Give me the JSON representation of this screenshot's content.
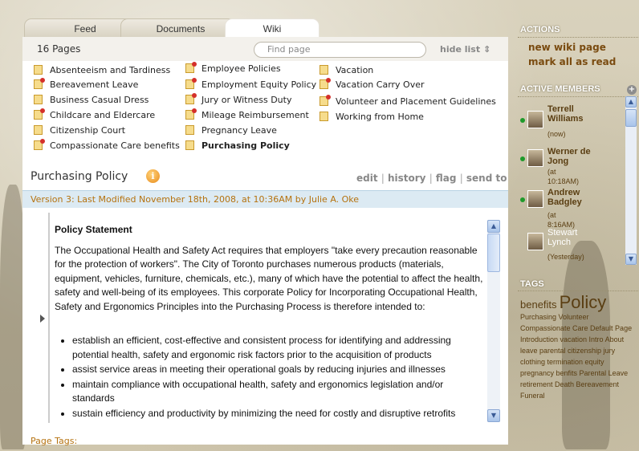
{
  "tabs": {
    "feed": "Feed",
    "documents": "Documents",
    "wiki": "Wiki"
  },
  "page_count": "16 Pages",
  "find_placeholder": "Find page",
  "hide_list": "hide list ⇕",
  "pages": [
    {
      "label": "Absenteeism and Tardiness",
      "pinned": false
    },
    {
      "label": "Bereavement Leave",
      "pinned": true
    },
    {
      "label": "Business Casual Dress",
      "pinned": false
    },
    {
      "label": "Childcare and Eldercare",
      "pinned": true
    },
    {
      "label": "Citizenship Court",
      "pinned": false
    },
    {
      "label": "Compassionate Care benefits",
      "pinned": true
    },
    {
      "label": "Employee Policies",
      "pinned": true
    },
    {
      "label": "Employment Equity Policy",
      "pinned": true
    },
    {
      "label": "Jury or Witness Duty",
      "pinned": true
    },
    {
      "label": "Mileage Reimbursement",
      "pinned": true
    },
    {
      "label": "Pregnancy Leave",
      "pinned": false
    },
    {
      "label": "Purchasing Policy",
      "pinned": false,
      "current": true
    },
    {
      "label": "Vacation",
      "pinned": false
    },
    {
      "label": "Vacation Carry Over",
      "pinned": true
    },
    {
      "label": "Volunteer and Placement Guidelines",
      "pinned": true
    },
    {
      "label": "Working from Home",
      "pinned": false
    }
  ],
  "page_title": "Purchasing Policy",
  "page_actions": {
    "edit": "edit",
    "history": "history",
    "flag": "flag",
    "send_to": "send to"
  },
  "version_text": "Version 3: Last Modified November 18th, 2008, at 10:36AM by Julie A. Oke",
  "policy": {
    "heading": "Policy Statement",
    "body": "The Occupational Health and Safety Act requires that employers \"take every precaution reasonable for the protection of workers\". The City of Toronto purchases numerous products (materials, equipment, vehicles, furniture, chemicals, etc.), many of which have the potential to affect the health, safety and well-being of its employees. This corporate Policy for Incorporating Occupational Health, Safety and Ergonomics Principles into the Purchasing Process is therefore intended to:",
    "bullets": [
      "establish an efficient, cost-effective and consistent process for identifying and addressing potential health, safety and ergonomic risk factors prior to the acquisition of products",
      "assist service areas in meeting their operational goals by reducing injuries and illnesses",
      "maintain compliance with occupational health, safety and ergonomics legislation and/or standards",
      "sustain efficiency and productivity by minimizing the need for costly and disruptive retrofits"
    ]
  },
  "page_tags_label": "Page Tags:",
  "right": {
    "actions_heading": "ACTIONS",
    "new_wiki_page": "new wiki page",
    "mark_all_read": "mark all as read",
    "members_heading": "ACTIVE MEMBERS",
    "members": [
      {
        "name": "Terrell Williams",
        "time": "(now)",
        "online": true
      },
      {
        "name": "Werner de Jong",
        "time": "(at 10:18AM)",
        "online": true
      },
      {
        "name": "Andrew Badgley",
        "time": "(at 8:16AM)",
        "online": true
      },
      {
        "name": "Stewart Lynch",
        "time": "(Yesterday)",
        "online": false
      }
    ],
    "tags_heading": "TAGS",
    "tags": {
      "benefits": "benefits",
      "policy": "Policy",
      "rest": "Purchasing Volunteer Compassionate Care Default Page Introduction vacation Intro About leave parental citizenship jury clothing termination equity pregnancy benfits Parental Leave retirement Death Bereavement Funeral"
    }
  },
  "colors": {
    "accent": "#b5720f",
    "link": "#7a4b10",
    "version_bar": "#dceaf3",
    "online": "#1e9a2a"
  }
}
